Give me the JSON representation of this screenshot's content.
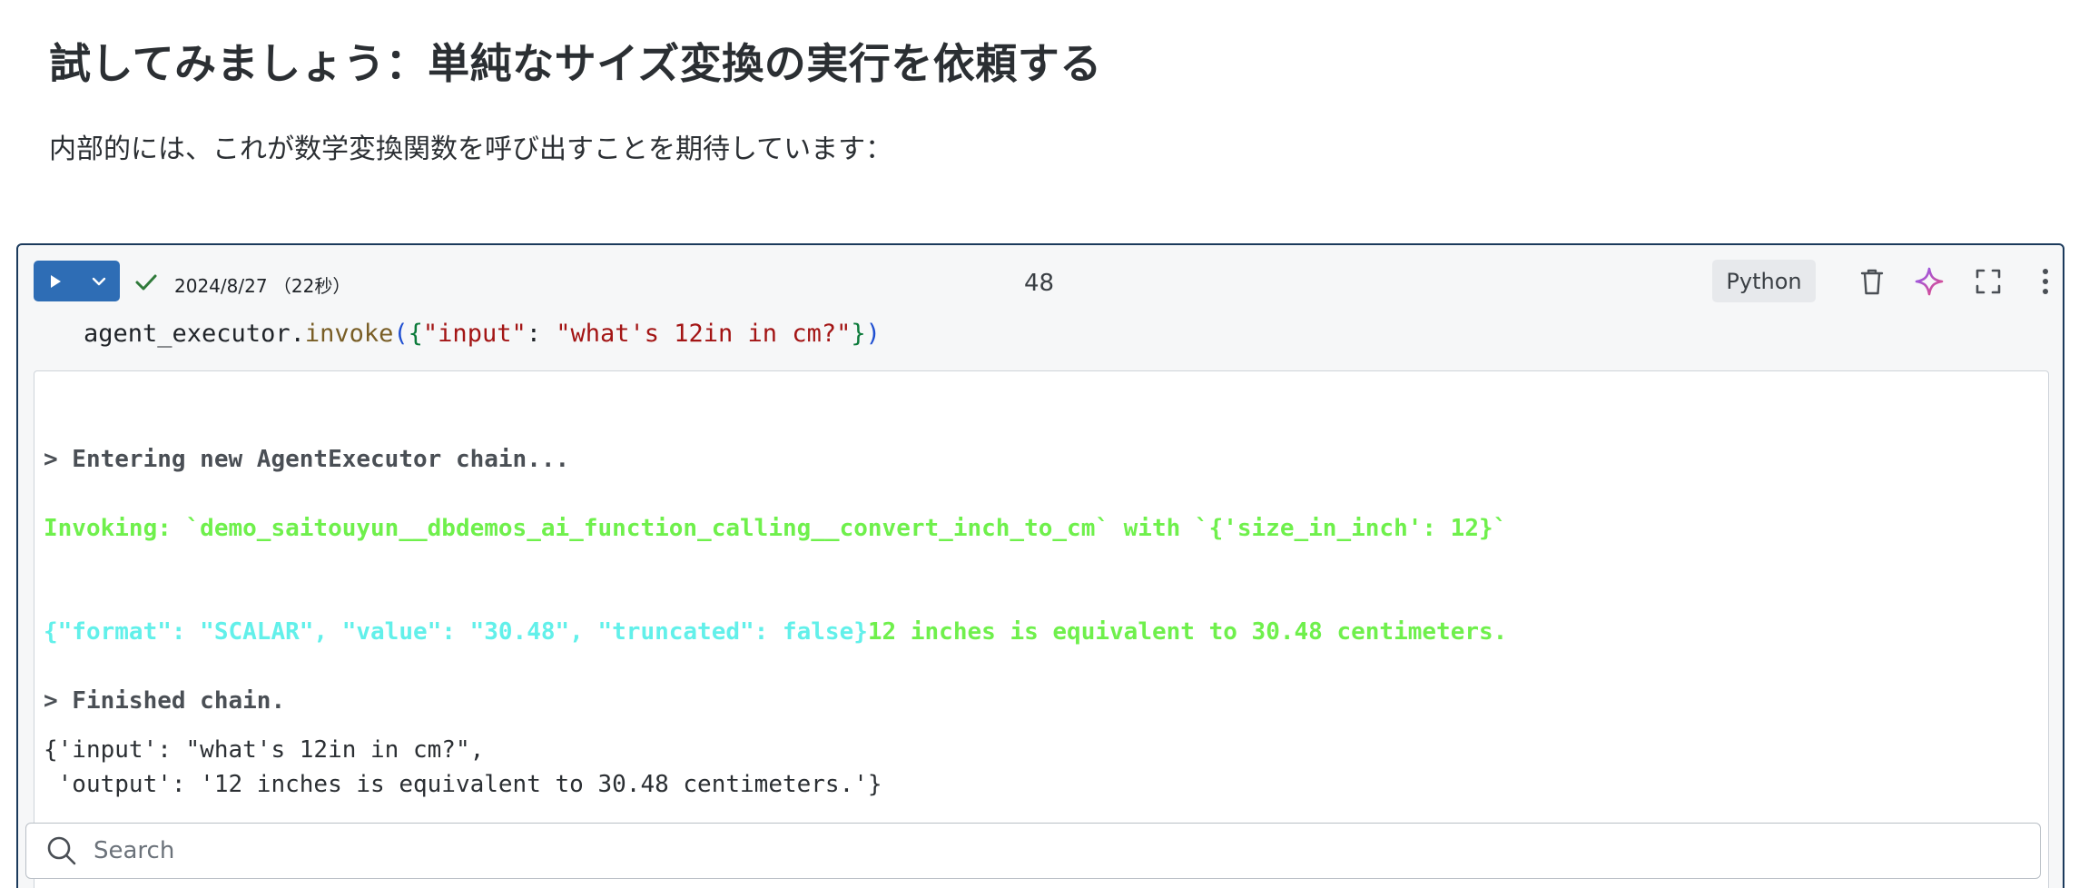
{
  "heading": "試してみましょう：単純なサイズ変換の実行を依頼する",
  "subtext": "内部的には、これが数学変換関数を呼び出すことを期待しています：",
  "cell": {
    "timestamp": "2024/8/27 （22秒）",
    "number": "48",
    "language": "Python",
    "code": {
      "obj": "agent_executor.",
      "method": "invoke",
      "open_paren": "(",
      "open_brace": "{",
      "key": "\"input\"",
      "colon": ": ",
      "value": "\"what's 12in in cm?\"",
      "close_brace": "}",
      "close_paren": ")"
    },
    "output": {
      "entering": "> Entering new AgentExecutor chain...",
      "invoking": "Invoking: `demo_saitouyun__dbdemos_ai_function_calling__convert_inch_to_cm` with `{'size_in_inch': 12}`",
      "json_result": "{\"format\": \"SCALAR\", \"value\": \"30.48\", \"truncated\": false}",
      "answer": "12 inches is equivalent to 30.48 centimeters.",
      "finished": "> Finished chain.",
      "result_line1": "{'input': \"what's 12in in cm?\",",
      "result_line2": " 'output': '12 inches is equivalent to 30.48 centimeters.'}"
    },
    "search": {
      "placeholder": "Search"
    }
  },
  "colors": {
    "run_button": "#2e6db5",
    "cell_border": "#1b3a5c",
    "output_green": "#6ff04c",
    "output_cyan": "#62f0ea",
    "sparkle_gradient": [
      "#8b5cf6",
      "#e64980"
    ]
  },
  "icons": [
    "play-icon",
    "chevron-down-icon",
    "check-icon",
    "trash-icon",
    "sparkle-icon",
    "fullscreen-icon",
    "kebab-menu-icon",
    "search-icon"
  ]
}
